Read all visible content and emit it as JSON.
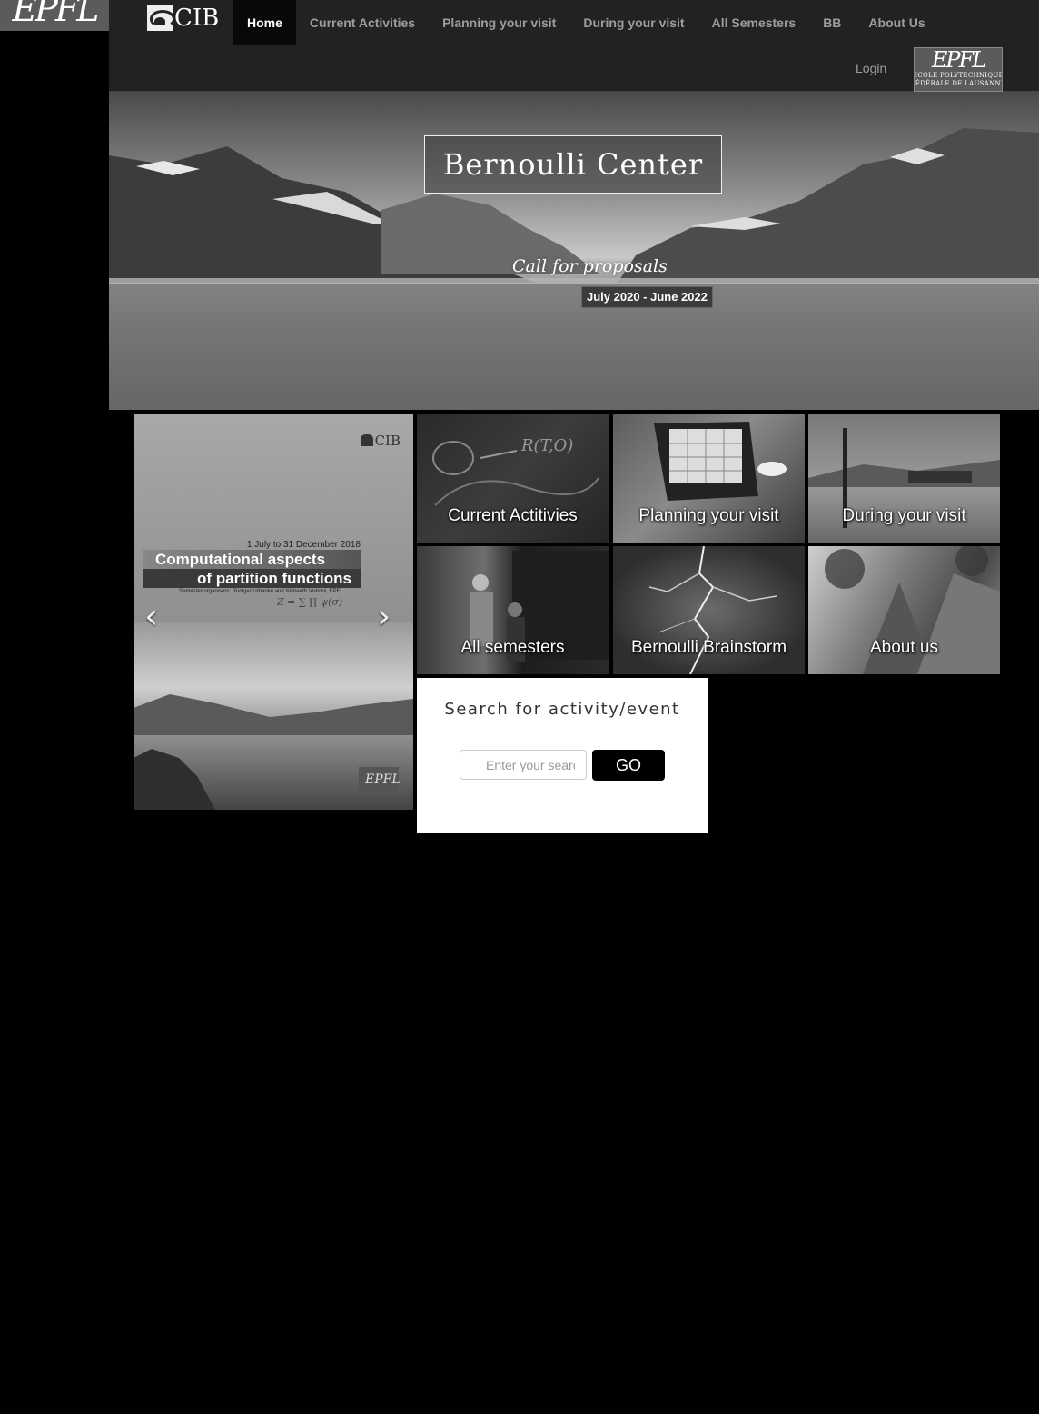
{
  "sidebar_logo": {
    "text": "EPFL"
  },
  "navbar": {
    "brand": "CIB",
    "items": [
      {
        "label": "Home",
        "active": true
      },
      {
        "label": "Current Activities"
      },
      {
        "label": "Planning your visit"
      },
      {
        "label": "During your visit"
      },
      {
        "label": "All Semesters"
      },
      {
        "label": "BB"
      },
      {
        "label": "About Us"
      }
    ],
    "login_label": "Login",
    "epfl_badge": {
      "mark": "EPFL",
      "line1": "ÉCOLE POLYTECHNIQUE",
      "line2": "FÉDÉRALE DE LAUSANNE"
    }
  },
  "hero": {
    "title": "Bernoulli Center",
    "subtitle": "Call for proposals",
    "dates": "July 2020 - June 2022"
  },
  "carousel": {
    "slide": {
      "brand": "CIB",
      "dates": "1 July to 31 December 2018",
      "title_line1": "Computational aspects",
      "title_line2": "of partition functions",
      "organisers": "Semester organisers: Rüdiger Urbanke and Nisheeth Vishnoi, EPFL",
      "formula": "Z = ∑ ∏ ψ(σ)"
    },
    "prev_icon": "chevron-left-icon",
    "next_icon": "chevron-right-icon"
  },
  "tiles": [
    {
      "label": "Current Actitivies"
    },
    {
      "label": "Planning your visit"
    },
    {
      "label": "During your visit"
    },
    {
      "label": "All semesters"
    },
    {
      "label": "Bernoulli Brainstorm"
    },
    {
      "label": "About us"
    }
  ],
  "search": {
    "title": "Search for activity/event",
    "placeholder": "Enter your search",
    "value": "",
    "button_label": "GO"
  }
}
